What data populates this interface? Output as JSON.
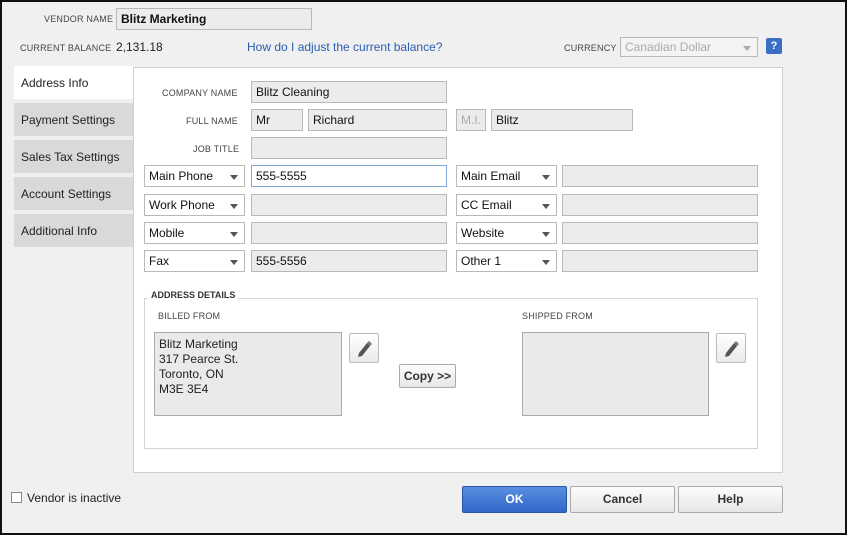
{
  "header": {
    "vendor_name_label": "VENDOR NAME",
    "vendor_name_value": "Blitz Marketing",
    "current_balance_label": "CURRENT BALANCE",
    "current_balance_value": "2,131.18",
    "adjust_balance_link": "How do I adjust the current balance?",
    "currency_label": "CURRENCY",
    "currency_value": "Canadian Dollar",
    "help_label": "?"
  },
  "tabs": [
    {
      "label": "Address Info",
      "active": true
    },
    {
      "label": "Payment Settings",
      "active": false
    },
    {
      "label": "Sales Tax Settings",
      "active": false
    },
    {
      "label": "Account Settings",
      "active": false
    },
    {
      "label": "Additional Info",
      "active": false
    }
  ],
  "form": {
    "company_name_label": "COMPANY NAME",
    "company_name_value": "Blitz Cleaning",
    "full_name_label": "FULL NAME",
    "salutation_value": "Mr",
    "first_name_value": "Richard",
    "mi_placeholder": "M.I.",
    "last_name_value": "Blitz",
    "job_title_label": "JOB TITLE",
    "job_title_value": "",
    "phones": [
      {
        "type": "Main Phone",
        "value": "555-5555"
      },
      {
        "type": "Work Phone",
        "value": ""
      },
      {
        "type": "Mobile",
        "value": ""
      },
      {
        "type": "Fax",
        "value": "555-5556"
      }
    ],
    "contacts": [
      {
        "type": "Main Email",
        "value": ""
      },
      {
        "type": "CC Email",
        "value": ""
      },
      {
        "type": "Website",
        "value": ""
      },
      {
        "type": "Other 1",
        "value": ""
      }
    ]
  },
  "address": {
    "section_label": "ADDRESS DETAILS",
    "billed_from_label": "BILLED FROM",
    "billed_lines": [
      "Blitz Marketing",
      "317 Pearce St.",
      "Toronto, ON",
      "M3E 3E4"
    ],
    "shipped_from_label": "SHIPPED FROM",
    "shipped_lines": [],
    "copy_button": "Copy >>"
  },
  "footer": {
    "inactive_label": "Vendor is inactive",
    "ok_button": "OK",
    "cancel_button": "Cancel",
    "help_button": "Help"
  },
  "colors": {
    "link": "#2a5db0",
    "primary_button": "#3a72d4",
    "tab_inactive": "#d9d9d9"
  }
}
